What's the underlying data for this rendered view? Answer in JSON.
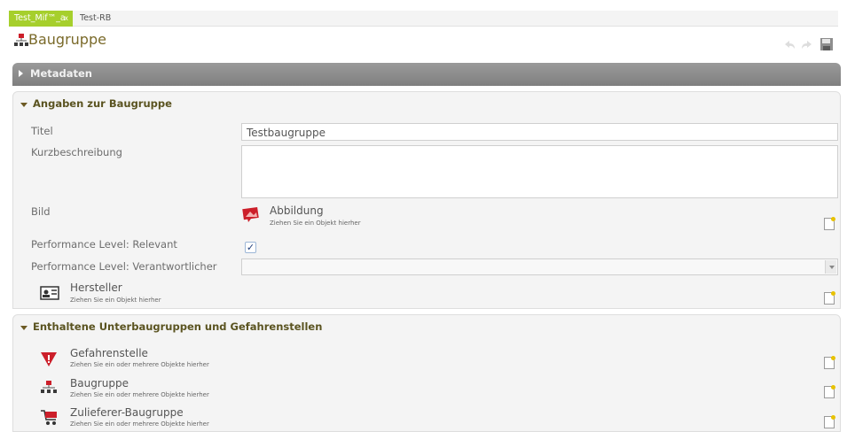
{
  "tabs": [
    {
      "label": "Test_Mif™_a",
      "close": "x"
    },
    {
      "label": "Test-RB"
    }
  ],
  "header": {
    "title": "Baugruppe"
  },
  "metadata_bar": {
    "label": "Metadaten"
  },
  "section_angaben": {
    "title": "Angaben zur Baugruppe",
    "titel_label": "Titel",
    "titel_value": "Testbaugruppe",
    "kurz_label": "Kurzbeschreibung",
    "kurz_value": "",
    "bild_label": "Bild",
    "abbildung_title": "Abbildung",
    "abbildung_hint": "Ziehen Sie ein Objekt hierher",
    "pl_relevant_label": "Performance Level: Relevant",
    "pl_relevant_checked": true,
    "pl_relevant_mark": "✓",
    "pl_verant_label": "Performance Level: Verantwortlicher",
    "hersteller_title": "Hersteller",
    "hersteller_hint": "Ziehen Sie ein Objekt hierher"
  },
  "section_enthaltene": {
    "title": "Enthaltene Unterbaugruppen und Gefahrenstellen",
    "items": [
      {
        "title": "Gefahrenstelle",
        "hint": "Ziehen Sie ein oder mehrere Objekte hierher",
        "icon": "warning-icon"
      },
      {
        "title": "Baugruppe",
        "hint": "Ziehen Sie ein oder mehrere Objekte hierher",
        "icon": "assembly-icon"
      },
      {
        "title": "Zulieferer-Baugruppe",
        "hint": "Ziehen Sie ein oder mehrere Objekte hierher",
        "icon": "cart-icon"
      }
    ]
  },
  "colors": {
    "tab_active": "#a6cf2c",
    "accent_red": "#cc1f2a",
    "section_title": "#5a5320",
    "metabar": "#8a8a8a"
  }
}
